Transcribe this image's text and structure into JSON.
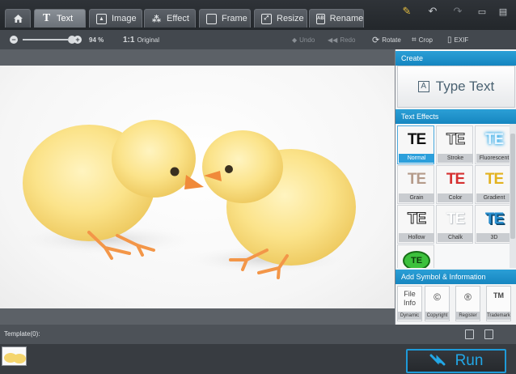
{
  "tabs": [
    {
      "label": "",
      "icon": "home-icon"
    },
    {
      "label": "Text",
      "icon": "text-icon"
    },
    {
      "label": "Image",
      "icon": "image-icon"
    },
    {
      "label": "Effect",
      "icon": "magic-wand-icon"
    },
    {
      "label": "Frame",
      "icon": "frame-icon"
    },
    {
      "label": "Resize",
      "icon": "resize-icon"
    },
    {
      "label": "Rename",
      "icon": "rename-icon"
    }
  ],
  "toolbar": {
    "zoom_value": "94 %",
    "original_label": "Original",
    "original_icon_text": "1:1",
    "undo_label": "Undo",
    "redo_label": "Redo",
    "rotate_label": "Rotate",
    "crop_label": "Crop",
    "exif_label": "EXIF"
  },
  "panel": {
    "create_header": "Create",
    "type_text_label": "Type Text",
    "type_text_icon": "A",
    "effects_header": "Text Effects",
    "effect_glyph": "TE",
    "effects": [
      {
        "label": "Normal",
        "selected": true
      },
      {
        "label": "Stroke"
      },
      {
        "label": "Fluorescent"
      },
      {
        "label": "Grain"
      },
      {
        "label": "Color"
      },
      {
        "label": "Gradient"
      },
      {
        "label": "Hollow"
      },
      {
        "label": "Chalk"
      },
      {
        "label": "3D"
      },
      {
        "label": ""
      }
    ],
    "symbol_header": "Add Symbol & Information",
    "symbols": [
      {
        "icon": "File Info",
        "label": "Dynamic"
      },
      {
        "icon": "©",
        "label": "Copyright"
      },
      {
        "icon": "®",
        "label": "Register"
      },
      {
        "icon": "TM",
        "label": "Trademark"
      }
    ]
  },
  "template_label": "Template(0):",
  "run_label": "Run",
  "colors": {
    "accent": "#1e9ad8",
    "selected_label": "#2c9fdb"
  }
}
